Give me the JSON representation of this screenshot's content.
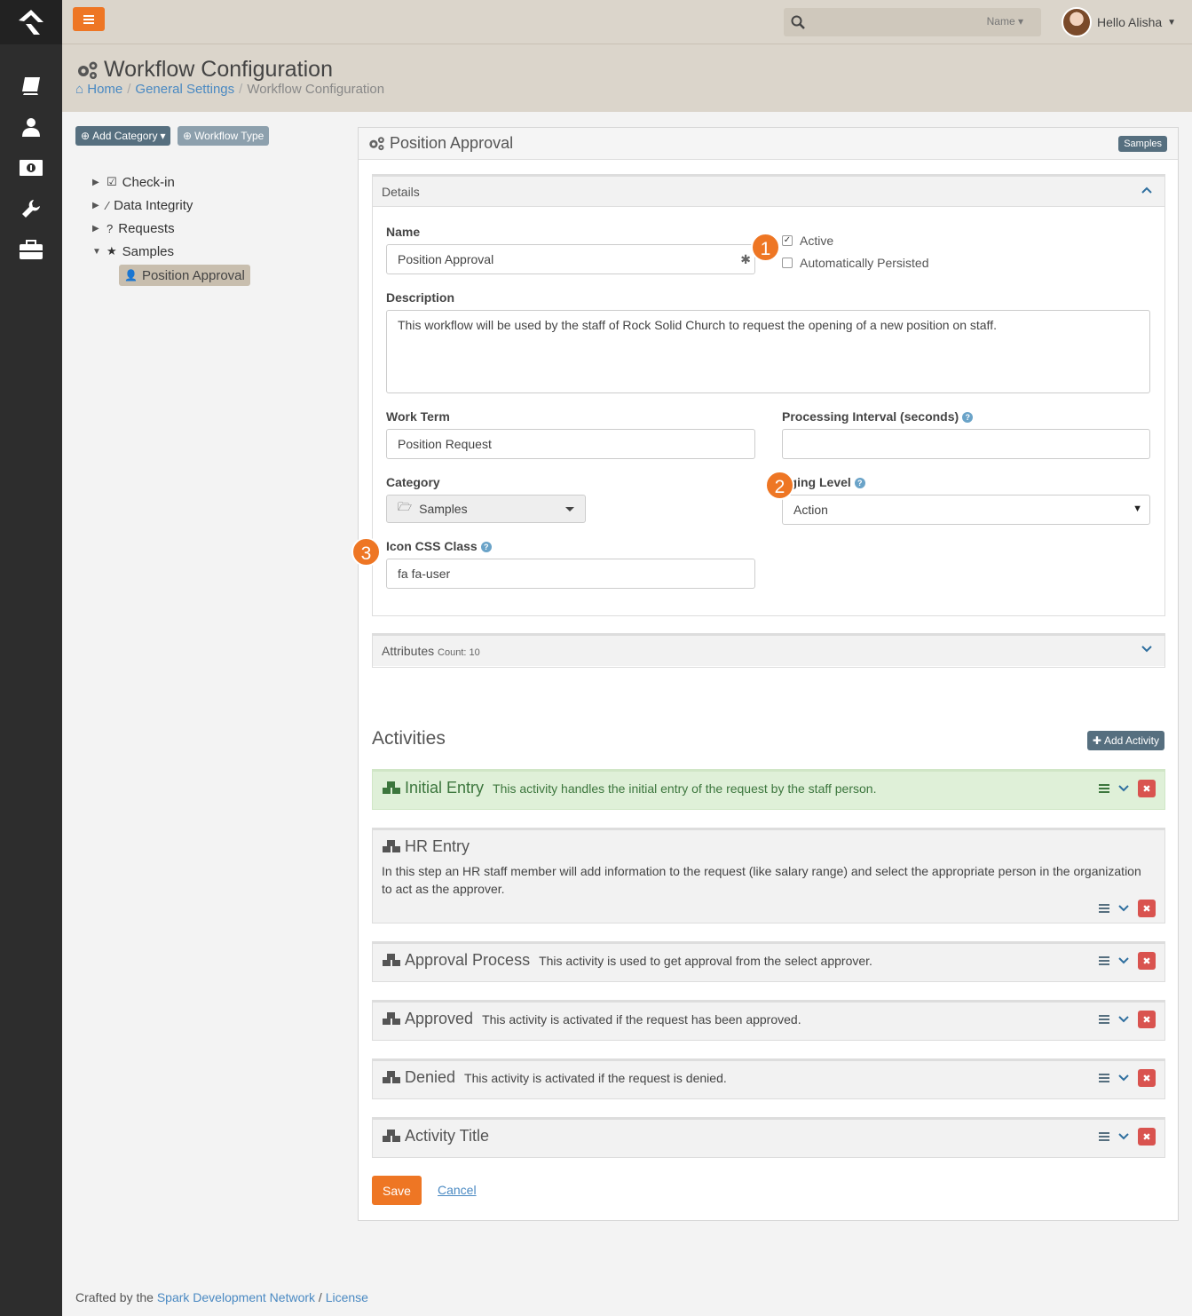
{
  "topbar": {
    "search_scope": "Name",
    "greeting": "Hello Alisha"
  },
  "page": {
    "title": "Workflow Configuration",
    "breadcrumb": [
      "Home",
      "General Settings",
      "Workflow Configuration"
    ]
  },
  "tree": {
    "add_category": "Add Category",
    "workflow_type": "Workflow Type",
    "items": [
      "Check-in",
      "Data Integrity",
      "Requests",
      "Samples"
    ],
    "selected": "Position Approval"
  },
  "panel": {
    "title": "Position Approval",
    "tag": "Samples"
  },
  "details": {
    "header": "Details",
    "name_label": "Name",
    "name_value": "Position Approval",
    "active_label": "Active",
    "persisted_label": "Automatically Persisted",
    "description_label": "Description",
    "description_value": "This workflow will be used by the staff of Rock Solid Church to request the opening of a new position on staff.",
    "work_term_label": "Work Term",
    "work_term_value": "Position Request",
    "interval_label": "Processing Interval (seconds)",
    "interval_value": "",
    "category_label": "Category",
    "category_value": "Samples",
    "logging_label": "gging Level",
    "logging_value": "Action",
    "icon_label": "Icon CSS Class",
    "icon_value": "fa fa-user"
  },
  "attributes": {
    "header": "Attributes",
    "count": "Count: 10"
  },
  "badges": [
    "1",
    "2",
    "3"
  ],
  "activities": {
    "title": "Activities",
    "add_label": "Add Activity",
    "items": [
      {
        "name": "Initial Entry",
        "desc": "This activity handles the initial entry of the request by the staff person."
      },
      {
        "name": "HR Entry",
        "desc": "In this step an HR staff member will add information to the request (like salary range) and select the appropriate person in the organization to act as the approver."
      },
      {
        "name": "Approval Process",
        "desc": "This activity is used to get approval from the select approver."
      },
      {
        "name": "Approved",
        "desc": "This activity is activated if the request has been approved."
      },
      {
        "name": "Denied",
        "desc": "This activity is activated if the request is denied."
      },
      {
        "name": "Activity Title",
        "desc": ""
      }
    ]
  },
  "actions": {
    "save": "Save",
    "cancel": "Cancel"
  },
  "footer": {
    "prefix": "Crafted by the",
    "link1": "Spark Development Network",
    "sep": "/",
    "link2": "License"
  },
  "colors": {
    "accent": "#ee7624",
    "rail": "#2d2d2d",
    "header": "#dbd5cb",
    "danger": "#d9534f",
    "success_bg": "#dff0d8"
  }
}
